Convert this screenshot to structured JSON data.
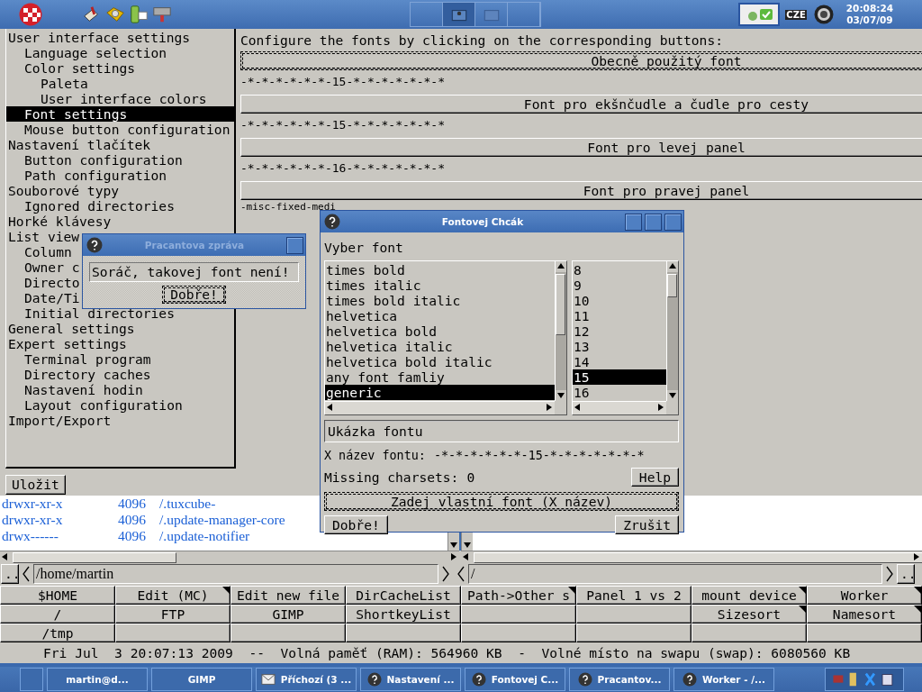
{
  "top_panel": {
    "keyboard_layout": "CZE",
    "clock": {
      "time": "20:08:24",
      "date": "03/07/09"
    }
  },
  "settings_window": {
    "tree": [
      {
        "label": "User interface settings",
        "selected": false,
        "children": [
          {
            "label": "Language selection",
            "selected": false
          },
          {
            "label": "Color settings",
            "selected": false,
            "children": [
              {
                "label": "Paleta",
                "selected": false
              },
              {
                "label": "User interface colors",
                "selected": false
              }
            ]
          },
          {
            "label": "Font settings",
            "selected": true
          },
          {
            "label": "Mouse button configuration",
            "selected": false
          }
        ]
      },
      {
        "label": "Nastavení tlačítek",
        "selected": false,
        "children": [
          {
            "label": "Button configuration",
            "selected": false
          },
          {
            "label": "Path configuration",
            "selected": false
          }
        ]
      },
      {
        "label": "Souborové typy",
        "selected": false,
        "children": [
          {
            "label": "Ignored directories",
            "selected": false
          }
        ]
      },
      {
        "label": "Horké klávesy",
        "selected": false
      },
      {
        "label": "List view",
        "selected": false,
        "children": [
          {
            "label": "Column",
            "selected": false
          },
          {
            "label": "Owner c",
            "selected": false
          },
          {
            "label": "Directo",
            "selected": false
          },
          {
            "label": "Date/Ti",
            "selected": false
          },
          {
            "label": "Initial directories",
            "selected": false
          }
        ]
      },
      {
        "label": "General settings",
        "selected": false
      },
      {
        "label": "Expert settings",
        "selected": false,
        "children": [
          {
            "label": "Terminal program",
            "selected": false
          },
          {
            "label": "Directory caches",
            "selected": false
          },
          {
            "label": "Nastavení hodin",
            "selected": false
          },
          {
            "label": "Layout configuration",
            "selected": false
          }
        ]
      },
      {
        "label": "Import/Export",
        "selected": false
      }
    ],
    "save_button": "Uložit",
    "heading": "Configure the fonts by clicking on the corresponding buttons:",
    "font_buttons": [
      {
        "label": "Obecně použitý font",
        "focused": true,
        "xname": "-*-*-*-*-*-*-15-*-*-*-*-*-*-*"
      },
      {
        "label": "Font pro ekšnčudle a čudle pro cesty",
        "focused": false,
        "xname": "-*-*-*-*-*-*-15-*-*-*-*-*-*-*"
      },
      {
        "label": "Font pro levej panel",
        "focused": false,
        "xname": "-*-*-*-*-*-*-16-*-*-*-*-*-*-*"
      },
      {
        "label": "Font pro pravej panel",
        "focused": false,
        "xname": "-misc-fixed-medi"
      }
    ]
  },
  "file_panels": {
    "left": {
      "rows": [
        {
          "permissions": "drwxr-xr-x",
          "size": "4096",
          "name": "/.tuxcube-"
        },
        {
          "permissions": "drwxr-xr-x",
          "size": "4096",
          "name": "/.update-manager-core"
        },
        {
          "permissions": "drwx------",
          "size": "4096",
          "name": "/.update-notifier"
        }
      ],
      "parent_button": "..",
      "path": "/home/martin"
    },
    "right": {
      "path": "/",
      "parent_button": ".."
    }
  },
  "button_grid": [
    [
      {
        "label": "$HOME",
        "marked": false
      },
      {
        "label": "Edit (MC)",
        "marked": true
      },
      {
        "label": "Edit new file",
        "marked": false
      },
      {
        "label": "DirCacheList",
        "marked": false
      },
      {
        "label": "Path->Other s",
        "marked": true
      },
      {
        "label": "Panel 1 vs 2",
        "marked": false
      },
      {
        "label": "mount device",
        "marked": true
      },
      {
        "label": "Worker",
        "marked": true
      }
    ],
    [
      {
        "label": "/",
        "marked": false
      },
      {
        "label": "FTP",
        "marked": false
      },
      {
        "label": "GIMP",
        "marked": false
      },
      {
        "label": "ShortkeyList",
        "marked": false
      },
      {
        "marked": false
      },
      {
        "marked": false
      },
      {
        "label": "Sizesort",
        "marked": true
      },
      {
        "label": "Namesort",
        "marked": true
      }
    ],
    [
      {
        "label": "/tmp",
        "marked": false
      },
      {
        "marked": false
      },
      {
        "marked": false
      },
      {
        "marked": false
      },
      {
        "marked": false
      },
      {
        "marked": false
      },
      {
        "marked": false
      },
      {
        "marked": false
      }
    ]
  ],
  "status_line": "Fri Jul  3 20:07:13 2009  --  Volná paměť (RAM): 564960 KB  -  Volné místo na swapu (swap): 6080560 KB",
  "message_dialog": {
    "title": "Pracantova zpráva",
    "message": "Soráč, takovej font není!",
    "ok_button": "Dobře!"
  },
  "font_dialog": {
    "title": "Fontovej Chcák",
    "prompt": "Vyber font",
    "families": [
      {
        "label": "times bold",
        "selected": false
      },
      {
        "label": "times italic",
        "selected": false
      },
      {
        "label": "times bold italic",
        "selected": false
      },
      {
        "label": "helvetica",
        "selected": false
      },
      {
        "label": "helvetica bold",
        "selected": false
      },
      {
        "label": "helvetica italic",
        "selected": false
      },
      {
        "label": "helvetica bold italic",
        "selected": false
      },
      {
        "label": "any font famliy",
        "selected": false
      },
      {
        "label": "generic",
        "selected": true
      }
    ],
    "sizes": [
      {
        "label": "8",
        "selected": false
      },
      {
        "label": "9",
        "selected": false
      },
      {
        "label": "10",
        "selected": false
      },
      {
        "label": "11",
        "selected": false
      },
      {
        "label": "12",
        "selected": false
      },
      {
        "label": "13",
        "selected": false
      },
      {
        "label": "14",
        "selected": false
      },
      {
        "label": "15",
        "selected": true
      },
      {
        "label": "16",
        "selected": false
      }
    ],
    "preview": "Ukázka fontu",
    "xname_label": "X název fontu:",
    "xname": "-*-*-*-*-*-*-15-*-*-*-*-*-*-*",
    "missing_label": "Missing charsets:",
    "missing_count": "0",
    "help_button": "Help",
    "custom_button": "Zadej vlastní font (X název)",
    "ok_button": "Dobře!",
    "cancel_button": "Zrušit"
  },
  "taskbar": {
    "tasks": [
      {
        "kind": "blank"
      },
      {
        "kind": "text",
        "label": "martin@d..."
      },
      {
        "kind": "text",
        "label": "GIMP"
      },
      {
        "kind": "mail",
        "label": "Příchozí (3 ..."
      },
      {
        "kind": "help",
        "label": "Nastavení ..."
      },
      {
        "kind": "help",
        "label": "Fontovej C..."
      },
      {
        "kind": "help",
        "label": "Pracantov..."
      },
      {
        "kind": "help",
        "label": "Worker - /..."
      }
    ]
  }
}
